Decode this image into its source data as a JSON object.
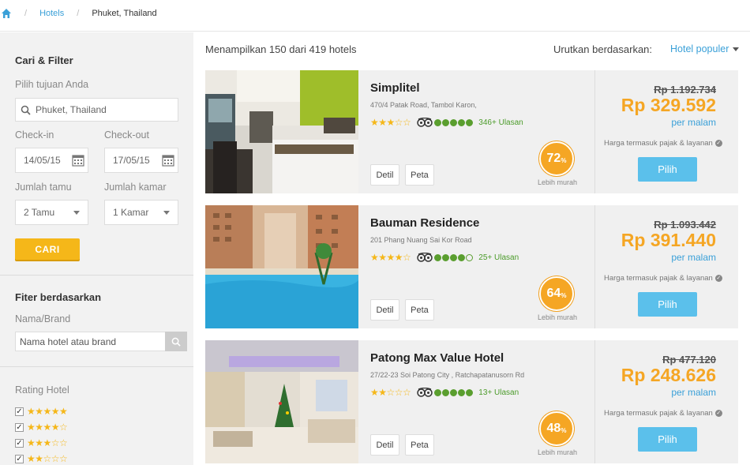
{
  "breadcrumb": {
    "home_icon": "home-icon",
    "items": [
      "Hotels",
      "Phuket, Thailand"
    ]
  },
  "sidebar": {
    "search_title": "Cari & Filter",
    "destination_label": "Pilih tujuan Anda",
    "destination_value": "Phuket, Thailand",
    "checkin_label": "Check-in",
    "checkin_value": "14/05/15",
    "checkout_label": "Check-out",
    "checkout_value": "17/05/15",
    "guests_label": "Jumlah tamu",
    "guests_value": "2 Tamu",
    "rooms_label": "Jumlah kamar",
    "rooms_value": "1 Kamar",
    "search_button": "CARI",
    "filter_title": "Fiter berdasarkan",
    "brand_label": "Nama/Brand",
    "brand_placeholder": "Nama hotel atau brand",
    "rating_title": "Rating Hotel",
    "ratings": [
      {
        "stars": "★★★★★",
        "checked": true
      },
      {
        "stars": "★★★★☆",
        "checked": true
      },
      {
        "stars": "★★★☆☆",
        "checked": true
      },
      {
        "stars": "★★☆☆☆",
        "checked": true
      }
    ]
  },
  "results": {
    "summary": "Menampilkan 150 dari 419 hotels",
    "sort_label": "Urutkan berdasarkan:",
    "sort_value": "Hotel populer"
  },
  "hotels": [
    {
      "name": "Simplitel",
      "address": "470/4 Patak Road, Tambol Karon,",
      "stars": "★★★☆☆",
      "ta_rating": 4.5,
      "reviews": "346+ Ulasan",
      "detail_label": "Detil",
      "map_label": "Peta",
      "discount": "72",
      "discount_unit": "%",
      "cheaper_label": "Lebih murah",
      "old_price": "Rp 1.192.734",
      "new_price": "Rp 329.592",
      "per_night": "per malam",
      "tax_note": "Harga termasuk pajak & layanan",
      "select_label": "Pilih"
    },
    {
      "name": "Bauman Residence",
      "address": "201 Phang Nuang Sai Kor Road",
      "stars": "★★★★☆",
      "ta_rating": 4.0,
      "reviews": "25+ Ulasan",
      "detail_label": "Detil",
      "map_label": "Peta",
      "discount": "64",
      "discount_unit": "%",
      "cheaper_label": "Lebih murah",
      "old_price": "Rp 1.093.442",
      "new_price": "Rp 391.440",
      "per_night": "per malam",
      "tax_note": "Harga termasuk pajak & layanan",
      "select_label": "Pilih"
    },
    {
      "name": "Patong Max Value Hotel",
      "address": "27/22-23 Soi Patong City , Ratchapatanusorn Rd",
      "stars": "★★☆☆☆",
      "ta_rating": 4.5,
      "reviews": "13+ Ulasan",
      "detail_label": "Detil",
      "map_label": "Peta",
      "discount": "48",
      "discount_unit": "%",
      "cheaper_label": "Lebih murah",
      "old_price": "Rp 477.120",
      "new_price": "Rp 248.626",
      "per_night": "per malam",
      "tax_note": "Harga termasuk pajak & layanan",
      "select_label": "Pilih"
    }
  ],
  "colors": {
    "accent": "#3aa0d8",
    "price": "#f5a624",
    "cta": "#5bc0eb",
    "search_button": "#f5b719",
    "tripadvisor": "#5a9e2f"
  }
}
